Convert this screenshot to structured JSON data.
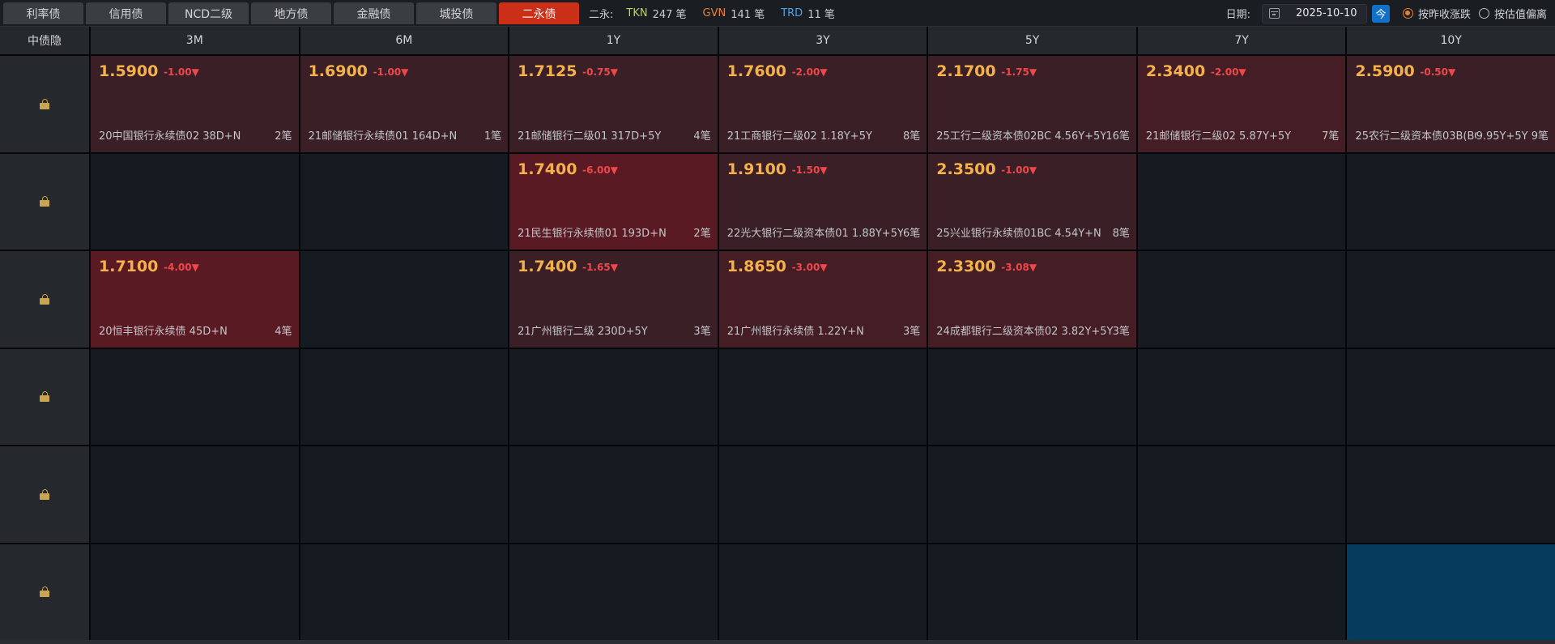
{
  "tabs": [
    {
      "label": "利率债",
      "active": false
    },
    {
      "label": "信用债",
      "active": false
    },
    {
      "label": "NCD二级",
      "active": false
    },
    {
      "label": "地方债",
      "active": false
    },
    {
      "label": "金融债",
      "active": false
    },
    {
      "label": "城投债",
      "active": false
    },
    {
      "label": "二永债",
      "active": true
    }
  ],
  "stats": {
    "label": "二永:",
    "tkn_tag": "TKN",
    "tkn_count": "247 笔",
    "gvn_tag": "GVN",
    "gvn_count": "141 笔",
    "trd_tag": "TRD",
    "trd_count": "11 笔"
  },
  "controls": {
    "date_label": "日期:",
    "date_value": "2025-10-10",
    "today_label": "今",
    "radio1_label": "按昨收涨跌",
    "radio2_label": "按估值偏离",
    "radio_selected": 1
  },
  "grid": {
    "corner_label": "中债隐",
    "columns": [
      "3M",
      "6M",
      "1Y",
      "3Y",
      "5Y",
      "7Y",
      "10Y"
    ],
    "rows": [
      {
        "cells": [
          {
            "yield": "1.5900",
            "change": "-1.00▼",
            "bond": "20中国银行永续债02 38D+N",
            "count": "2笔",
            "tone": "has"
          },
          {
            "yield": "1.6900",
            "change": "-1.00▼",
            "bond": "21邮储银行永续债01 164D+N",
            "count": "1笔",
            "tone": "has"
          },
          {
            "yield": "1.7125",
            "change": "-0.75▼",
            "bond": "21邮储银行二级01 317D+5Y",
            "count": "4笔",
            "tone": "has"
          },
          {
            "yield": "1.7600",
            "change": "-2.00▼",
            "bond": "21工商银行二级02 1.18Y+5Y",
            "count": "8笔",
            "tone": "has"
          },
          {
            "yield": "2.1700",
            "change": "-1.75▼",
            "bond": "25工行二级资本债02BC 4.56Y+5Y",
            "count": "16笔",
            "tone": "has"
          },
          {
            "yield": "2.3400",
            "change": "-2.00▼",
            "bond": "21邮储银行二级02 5.87Y+5Y",
            "count": "7笔",
            "tone": "mid"
          },
          {
            "yield": "2.5900",
            "change": "-0.50▼",
            "bond": "25农行二级资本债03B(BC",
            "count": "9.95Y+5Y 9笔",
            "tone": "has"
          }
        ]
      },
      {
        "cells": [
          null,
          null,
          {
            "yield": "1.7400",
            "change": "-6.00▼",
            "bond": "21民生银行永续债01 193D+N",
            "count": "2笔",
            "tone": "hot"
          },
          {
            "yield": "1.9100",
            "change": "-1.50▼",
            "bond": "22光大银行二级资本债01 1.88Y+5Y",
            "count": "6笔",
            "tone": "has"
          },
          {
            "yield": "2.3500",
            "change": "-1.00▼",
            "bond": "25兴业银行永续债01BC 4.54Y+N",
            "count": "8笔",
            "tone": "has"
          },
          null,
          null
        ]
      },
      {
        "cells": [
          {
            "yield": "1.7100",
            "change": "-4.00▼",
            "bond": "20恒丰银行永续债 45D+N",
            "count": "4笔",
            "tone": "hot"
          },
          null,
          {
            "yield": "1.7400",
            "change": "-1.65▼",
            "bond": "21广州银行二级 230D+5Y",
            "count": "3笔",
            "tone": "has"
          },
          {
            "yield": "1.8650",
            "change": "-3.00▼",
            "bond": "21广州银行永续债 1.22Y+N",
            "count": "3笔",
            "tone": "mid"
          },
          {
            "yield": "2.3300",
            "change": "-3.08▼",
            "bond": "24成都银行二级资本债02 3.82Y+5Y",
            "count": "3笔",
            "tone": "mid"
          },
          null,
          null
        ]
      },
      {
        "cells": [
          null,
          null,
          null,
          null,
          null,
          null,
          null
        ]
      },
      {
        "cells": [
          null,
          null,
          null,
          null,
          null,
          null,
          null
        ]
      },
      {
        "cells": [
          null,
          null,
          null,
          null,
          null,
          null,
          {
            "empty_selected": true
          }
        ]
      }
    ]
  }
}
